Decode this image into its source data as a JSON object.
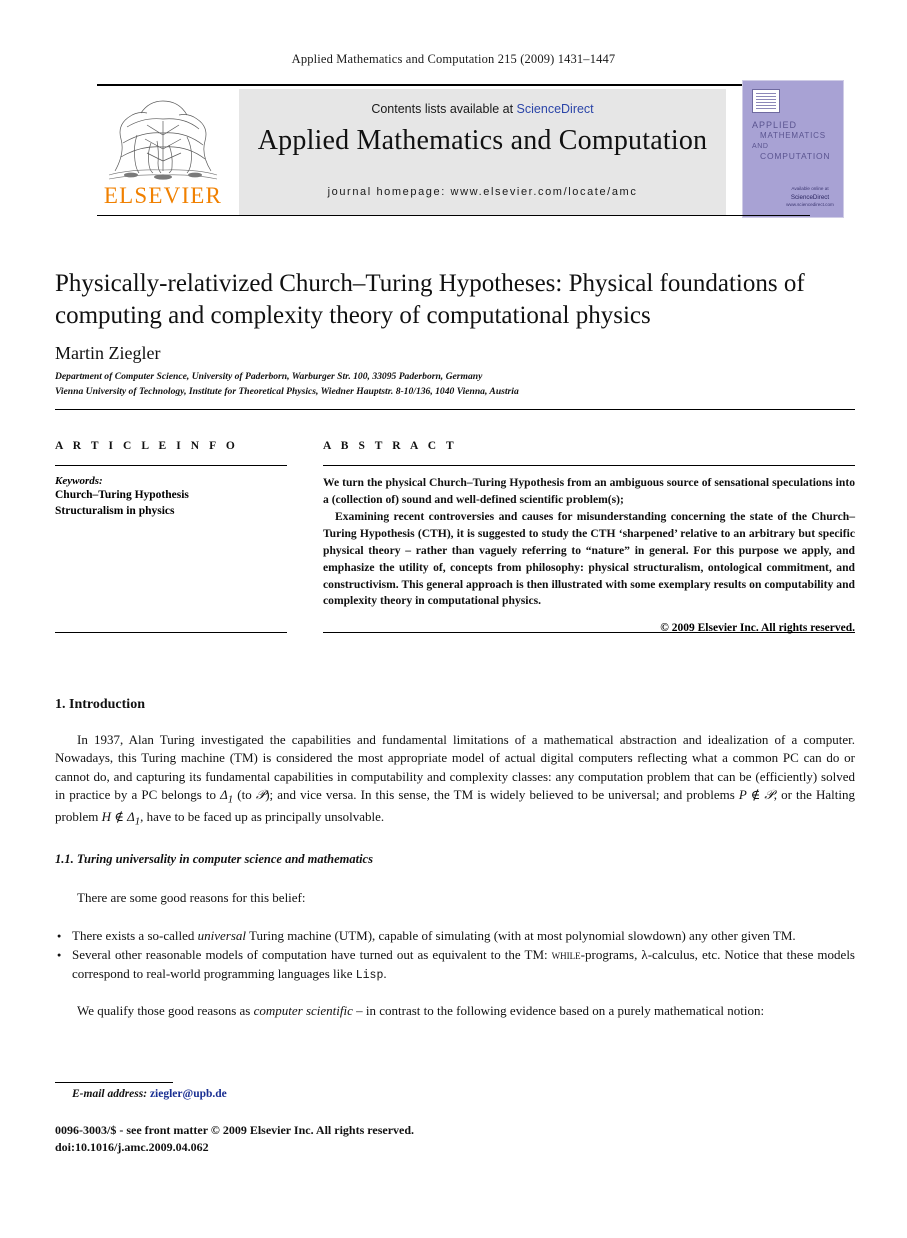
{
  "running_head": "Applied Mathematics and Computation 215 (2009) 1431–1447",
  "masthead": {
    "contents_prefix": "Contents lists available at ",
    "contents_link": "ScienceDirect",
    "journal_title": "Applied Mathematics and Computation",
    "homepage": "journal homepage: www.elsevier.com/locate/amc",
    "publisher_name": "ELSEVIER",
    "cover": {
      "line1": "APPLIED",
      "line2": "MATHEMATICS",
      "line3": "AND",
      "line4": "COMPUTATION",
      "footer_small": "Available online at",
      "footer_brand": "ScienceDirect",
      "footer_url": "www.sciencedirect.com"
    },
    "link_color": "#2b45a8",
    "elsevier_orange": "#F08000",
    "cover_bg": "#a8a2d4"
  },
  "article": {
    "title": "Physically-relativized Church–Turing Hypotheses: Physical foundations of computing and complexity theory of computational physics",
    "author": "Martin Ziegler",
    "affiliations": [
      "Department of Computer Science, University of Paderborn, Warburger Str. 100, 33095 Paderborn, Germany",
      "Vienna University of Technology, Institute for Theoretical Physics, Wiedner Hauptstr. 8-10/136, 1040 Vienna, Austria"
    ]
  },
  "article_info": {
    "heading": "A R T I C L E    I N F O",
    "keywords_label": "Keywords:",
    "keywords": [
      "Church–Turing Hypothesis",
      "Structuralism in physics"
    ]
  },
  "abstract": {
    "heading": "A B S T R A C T",
    "paragraph_1": "We turn the physical Church–Turing Hypothesis from an ambiguous source of sensational speculations into a (collection of) sound and well-defined scientific problem(s);",
    "paragraph_2": "Examining recent controversies and causes for misunderstanding concerning the state of the Church–Turing Hypothesis (CTH), it is suggested to study the CTH ‘sharpened’ relative to an arbitrary but specific physical theory – rather than vaguely referring to “nature” in general. For this purpose we apply, and emphasize the utility of, concepts from philosophy: physical structuralism, ontological commitment, and constructivism. This general approach is then illustrated with some exemplary results on computability and complexity theory in computational physics.",
    "copyright": "© 2009 Elsevier Inc. All rights reserved."
  },
  "body": {
    "section_1_heading": "1. Introduction",
    "intro_paragraph_part1": "In 1937, Alan Turing investigated the capabilities and fundamental limitations of a mathematical abstraction and idealization of a computer. Nowadays, this Turing machine (TM) is considered the most appropriate model of actual digital computers reflecting what a common PC can do or cannot do, and capturing its fundamental capabilities in computability and complexity classes: any computation problem that can be (efficiently) solved in practice by a PC belongs to ",
    "delta1_a": "Δ",
    "delta1_sub": "1",
    "intro_paragraph_part2": " (to ",
    "script_p": "𝒫",
    "intro_paragraph_part3": "); and vice versa. In this sense, the TM is widely believed to be universal; and problems ",
    "p_notin": "P ∉ 𝒫",
    "intro_paragraph_part4": ", or the Halting problem ",
    "h_notin": "H ∉ Δ",
    "h_notin_sub": "1",
    "intro_paragraph_part5": ", have to be faced up as principally unsolvable.",
    "subsection_1_1_heading": "1.1. Turing universality in computer science and mathematics",
    "belief_paragraph": "There are some good reasons for this belief:",
    "bullet_1_pre": "There exists a so-called ",
    "bullet_1_italic": "universal",
    "bullet_1_post": " Turing machine (UTM), capable of simulating (with at most polynomial slowdown) any other given TM.",
    "bullet_2_pre": "Several other reasonable models of computation have turned out as equivalent to the TM: ",
    "bullet_2_smallcaps": "while",
    "bullet_2_mid": "-programs, λ-calculus, etc. Notice that these models correspond to real-world programming languages like ",
    "bullet_2_mono": "Lisp",
    "bullet_2_end": ".",
    "closing_pre": "We qualify those good reasons as ",
    "closing_italic": "computer scientific",
    "closing_post": " – in contrast to the following evidence based on a purely mathematical notion:"
  },
  "footer": {
    "email_label": "E-mail address:",
    "email_address": "ziegler@upb.de",
    "imprint_line1": "0096-3003/$ - see front matter © 2009 Elsevier Inc. All rights reserved.",
    "imprint_line2": "doi:10.1016/j.amc.2009.04.062",
    "email_color": "#1a2f92"
  }
}
